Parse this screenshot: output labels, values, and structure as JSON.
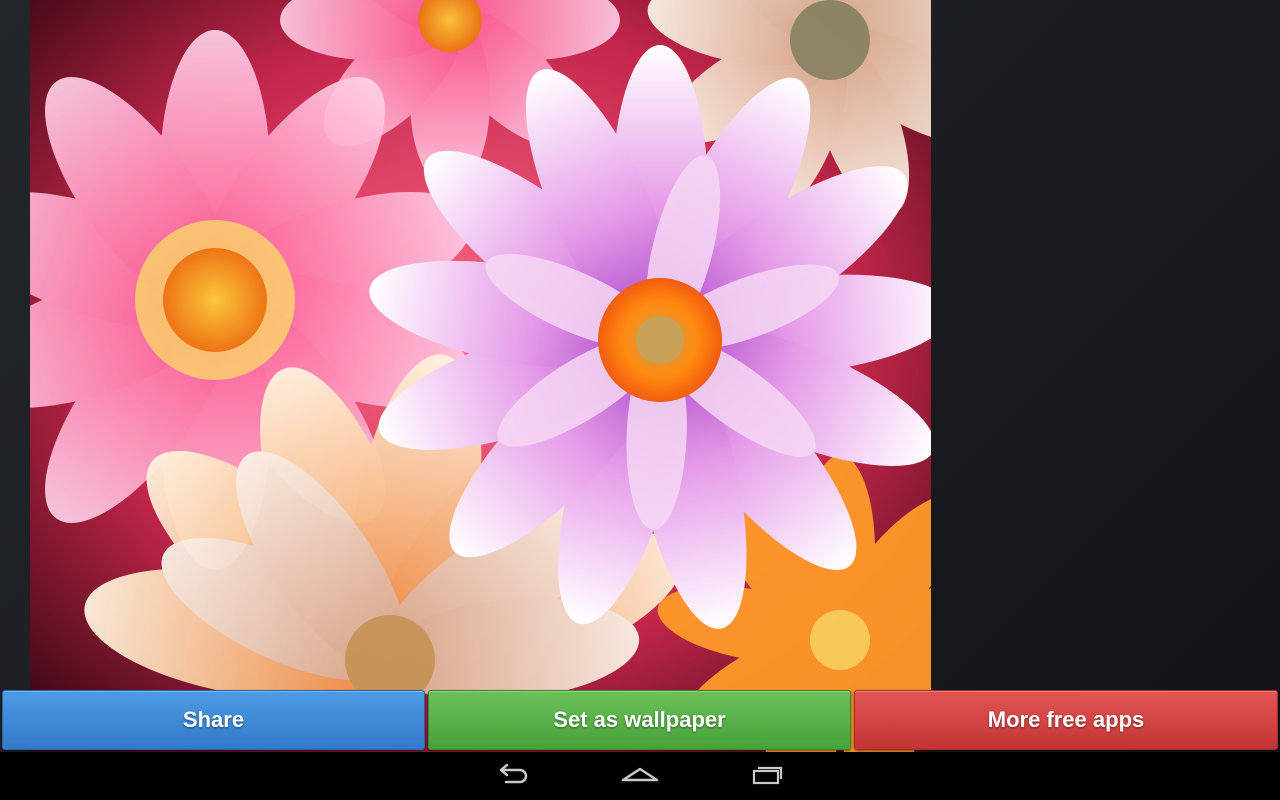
{
  "buttons": {
    "share_label": "Share",
    "set_wallpaper_label": "Set as wallpaper",
    "more_apps_label": "More free apps"
  },
  "colors": {
    "share": "#3f8ad6",
    "set_wallpaper": "#5ab14a",
    "more_apps": "#d44545",
    "navbar": "#000000"
  },
  "navbar": {
    "icons": [
      "back-icon",
      "home-icon",
      "recent-apps-icon"
    ]
  },
  "wallpaper": {
    "subject": "colorful flowers"
  }
}
